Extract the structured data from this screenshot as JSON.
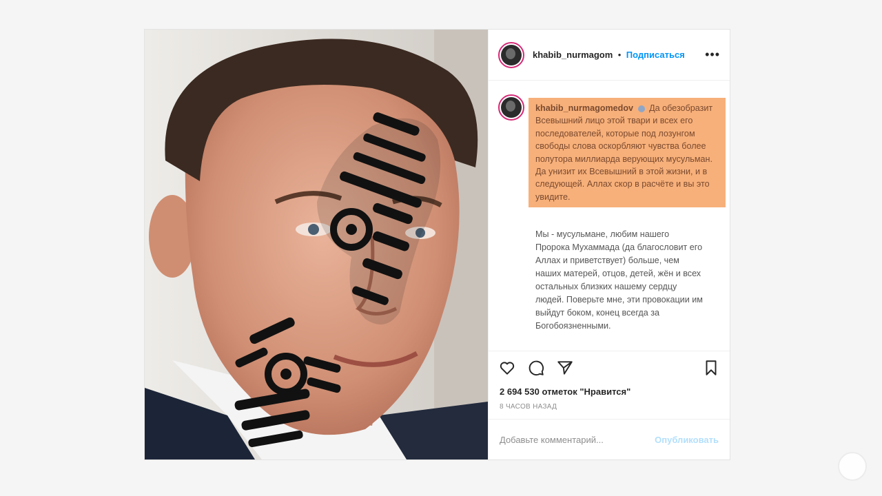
{
  "header": {
    "username": "khabib_nurmagom",
    "separator": "•",
    "follow_label": "Подписаться",
    "more_icon": "more-horizontal-icon"
  },
  "caption": {
    "author": "khabib_nurmagomedov",
    "highlighted_text": "Да обезобразит Всевышний лицо этой твари и всех его последователей, которые под лозунгом свободы слова оскорбляют чувства более полутора миллиарда верующих мусульман. Да унизит их Всевышний в этой жизни, и в следующей. Аллах скор в расчёте и вы это увидите.",
    "body_text": "Мы - мусульмане, любим нашего Пророка Мухаммада (да благословит его Аллах и приветствует) больше, чем наших матерей, отцов, детей, жён и всех остальных близких нашему сердцу людей. Поверьте мне, эти провокации им выйдут боком, конец всегда за Богобоязненными.",
    "highlight_color": "#f7b07a"
  },
  "actions": {
    "like_icon": "heart-icon",
    "comment_icon": "comment-icon",
    "share_icon": "send-icon",
    "save_icon": "bookmark-icon"
  },
  "likes_text": "2 694 530 отметок \"Нравится\"",
  "time_text": "8 ЧАСОВ НАЗАД",
  "comment_box": {
    "placeholder": "Добавьте комментарий...",
    "publish_label": "Опубликовать"
  },
  "colors": {
    "accent_blue": "#0095f6",
    "avatar_ring": "#d62976"
  }
}
